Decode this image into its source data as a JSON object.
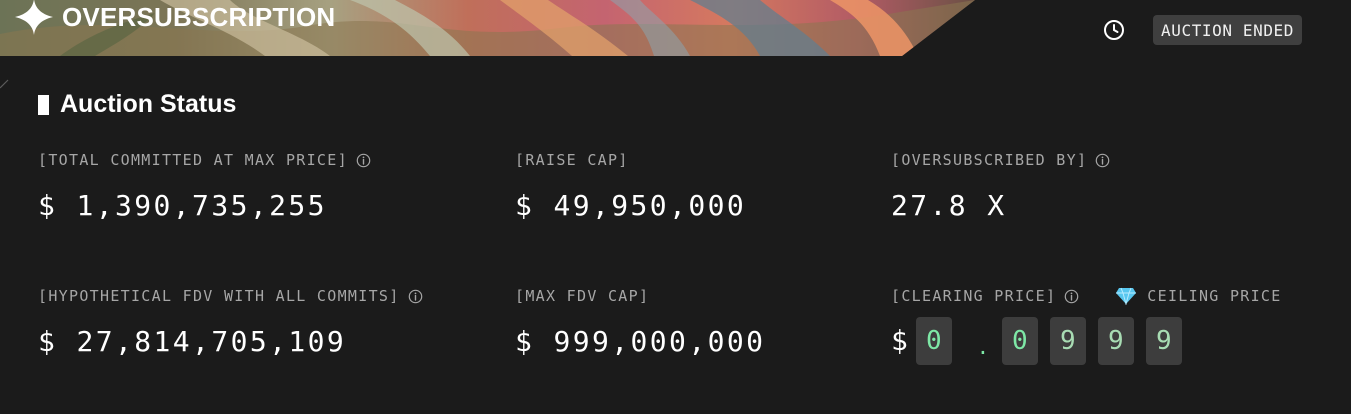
{
  "header": {
    "title": "OVERSUBSCRIPTION",
    "status_badge": "AUCTION ENDED"
  },
  "auction_status": {
    "heading": "Auction Status",
    "total_committed": {
      "label": "[TOTAL COMMITTED AT MAX PRICE]",
      "value": "$ 1,390,735,255"
    },
    "raise_cap": {
      "label": "[RAISE CAP]",
      "value": "$ 49,950,000"
    },
    "oversubscribed_by": {
      "label": "[OVERSUBSCRIBED BY]",
      "value": "27.8 X"
    },
    "hypothetical_fdv": {
      "label": "[HYPOTHETICAL FDV WITH ALL COMMITS]",
      "value": "$ 27,814,705,109"
    },
    "max_fdv_cap": {
      "label": "[MAX FDV CAP]",
      "value": "$ 999,000,000"
    },
    "clearing_price": {
      "label": "[CLEARING PRICE]",
      "ceiling_label": "CEILING PRICE",
      "currency": "$",
      "digits": [
        "0",
        ".",
        "0",
        "9",
        "9",
        "9"
      ]
    }
  },
  "icons": {
    "hero": "sparkle-icon",
    "status": "clock-icon",
    "info": "info-icon",
    "ceiling": "diamond-icon"
  },
  "colors": {
    "background": "#1b1b1b",
    "text": "#ffffff",
    "label": "#a6a6a6",
    "badge_bg": "#3f3f3f",
    "digit_bg": "#3d3d3d",
    "digit_green": "#7ee8a6",
    "ceiling_digit": "#a8dcb3",
    "diamond": "#58c7ef"
  }
}
